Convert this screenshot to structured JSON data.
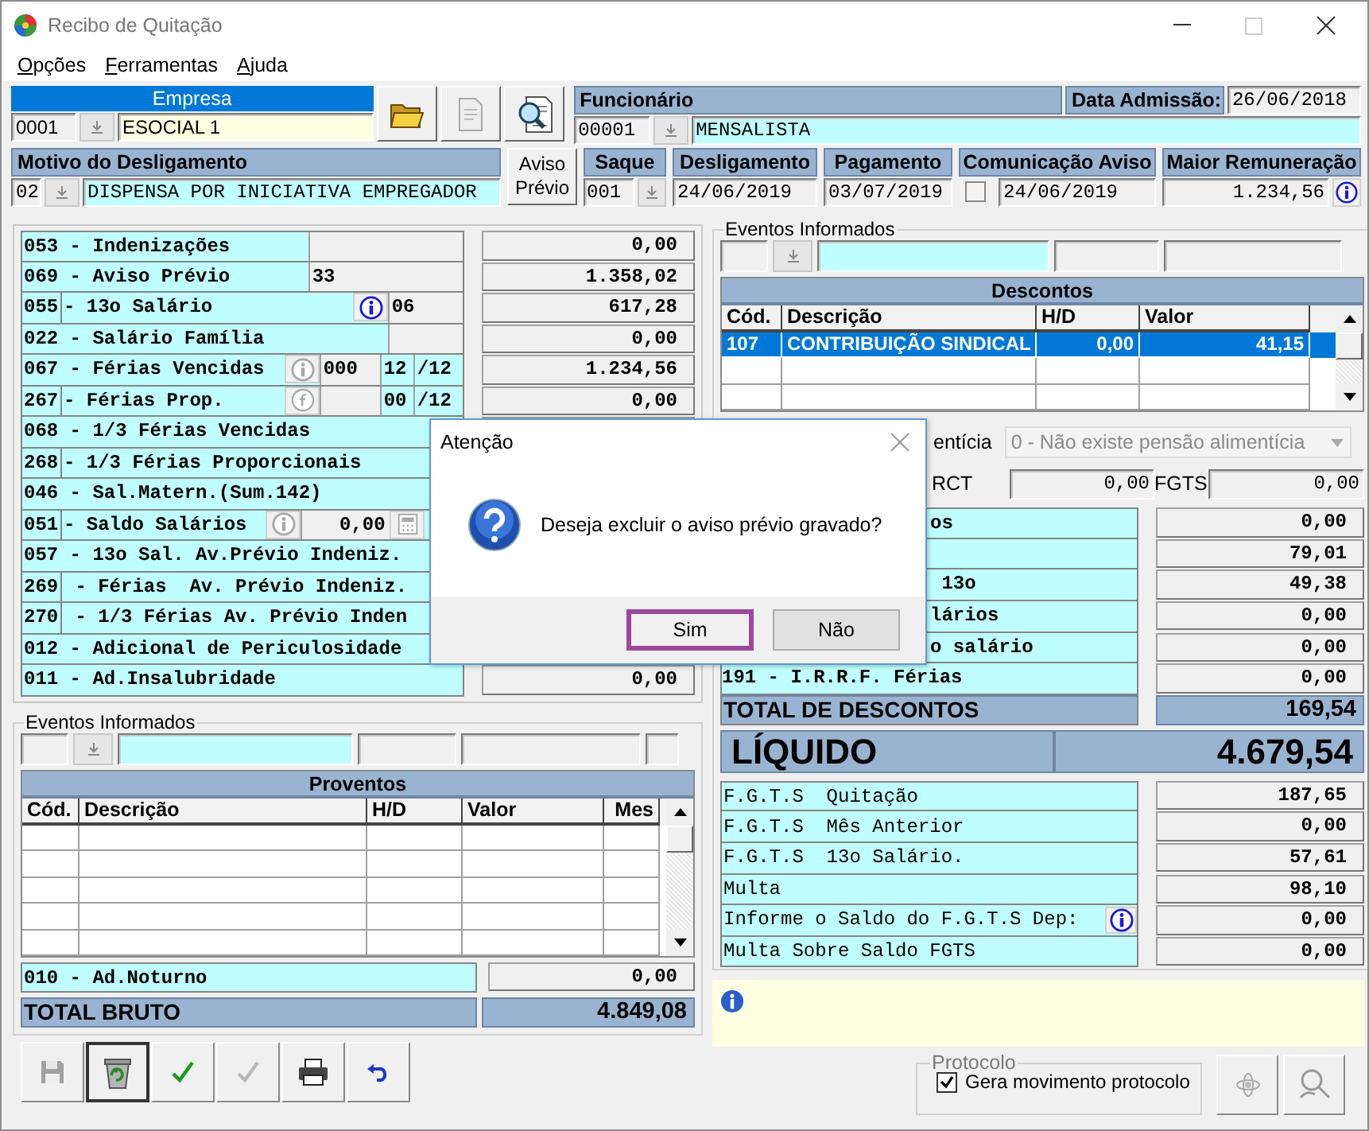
{
  "window": {
    "title": "Recibo de Quitação"
  },
  "menu": [
    {
      "label": "Opções"
    },
    {
      "label": "Ferramentas"
    },
    {
      "label": "Ajuda"
    }
  ],
  "empresa": {
    "header": "Empresa",
    "code": "0001",
    "name": "ESOCIAL 1"
  },
  "funcionario": {
    "header": "Funcionário",
    "admission_label": "Data Admissão:",
    "admission_date": "26/06/2018",
    "code": "00001",
    "name": "MENSALISTA"
  },
  "motivo": {
    "header": "Motivo do Desligamento",
    "code": "02",
    "text": "DISPENSA POR INICIATIVA EMPREGADOR"
  },
  "aviso_button": {
    "label": "Aviso Prévio"
  },
  "saque": {
    "header": "Saque",
    "code": "001"
  },
  "dates": [
    {
      "header": "Desligamento",
      "value": "24/06/2019"
    },
    {
      "header": "Pagamento",
      "value": "03/07/2019"
    }
  ],
  "comunicacao": {
    "header": "Comunicação Aviso",
    "checked": false,
    "value": "24/06/2019"
  },
  "maior_remuneracao": {
    "header": "Maior Remuneração",
    "value": "1.234,56"
  },
  "left_rows": [
    {
      "label": "053 - Indenizações",
      "extras": [
        {
          "kind": "extra-field"
        }
      ],
      "value": "0,00"
    },
    {
      "label": "069 - Aviso Prévio",
      "extras": [
        {
          "kind": "extra-field",
          "text": "33"
        }
      ],
      "value": "1.358,02"
    },
    {
      "code": "055",
      "label": "- 13o Salário",
      "extras": [
        {
          "kind": "info",
          "disabled": false
        },
        {
          "kind": "short-field",
          "text": "06"
        }
      ],
      "value": "617,28"
    },
    {
      "label": "022 - Salário Família",
      "extras": [
        {
          "kind": "short-field"
        }
      ],
      "value": "0,00"
    },
    {
      "label": "067 - Férias Vencidas",
      "extras": [
        {
          "kind": "info",
          "disabled": true
        },
        {
          "kind": "count-field",
          "text": "000"
        },
        {
          "kind": "month-field",
          "text": "12"
        },
        {
          "kind": "months-total",
          "text": "/12"
        }
      ],
      "value": "1.234,56"
    },
    {
      "code": "267",
      "label": "- Férias Prop.",
      "extras": [
        {
          "kind": "formula",
          "disabled": true
        },
        {
          "kind": "count-field"
        },
        {
          "kind": "month-field",
          "text": "00"
        },
        {
          "kind": "months-total",
          "text": "/12"
        }
      ],
      "value": "0,00"
    },
    {
      "label": "068 - 1/3 Férias Vencidas"
    },
    {
      "code": "268",
      "label": "- 1/3 Férias Proporcionais"
    },
    {
      "label": "046 - Sal.Matern.(Sum.142)"
    },
    {
      "code": "051",
      "label": "- Saldo Salários",
      "extras": [
        {
          "kind": "info",
          "disabled": true
        },
        {
          "kind": "amount-field",
          "text": "0,00"
        },
        {
          "kind": "calculator",
          "disabled": true
        }
      ]
    },
    {
      "label": "057 - 13o Sal. Av.Prévio Indeniz."
    },
    {
      "code": "269",
      "label": " - Férias  Av. Prévio Indeniz."
    },
    {
      "code": "270",
      "label": " - 1/3 Férias Av. Prévio Inden"
    },
    {
      "label": "012 - Adicional de Periculosidade"
    },
    {
      "label": "011 - Ad.Insalubridade",
      "value": "0,00"
    }
  ],
  "eventos_left": {
    "title": "Eventos Informados",
    "table_title": "Proventos",
    "columns": [
      "Cód.",
      "Descrição",
      "H/D",
      "Valor",
      "Mes"
    ]
  },
  "noturno": {
    "label": "010 - Ad.Noturno",
    "value": "0,00"
  },
  "total_bruto": {
    "label": "TOTAL BRUTO",
    "value": "4.849,08"
  },
  "toolbar": [
    {
      "kind": "save",
      "disabled": true,
      "focused": false
    },
    {
      "kind": "recycle",
      "disabled": false,
      "focused": true
    },
    {
      "kind": "confirm",
      "disabled": false,
      "focused": false
    },
    {
      "kind": "confirm",
      "disabled": true,
      "focused": false
    },
    {
      "kind": "print",
      "disabled": false,
      "focused": false
    },
    {
      "kind": "undo",
      "disabled": false,
      "focused": false
    }
  ],
  "eventos_right": {
    "title": "Eventos Informados",
    "table_title": "Descontos",
    "columns": [
      "Cód.",
      "Descrição",
      "H/D",
      "Valor"
    ],
    "rows": [
      {
        "cells": [
          "107",
          "CONTRIBUIÇÃO SINDICAL",
          "0,00",
          "41,15"
        ],
        "selected": true
      }
    ]
  },
  "pensao": {
    "label": "entícia",
    "value": "0 - Não existe pensão alimentícia",
    "disabled": true
  },
  "rct": {
    "label": "RCT",
    "value": "0,00"
  },
  "fgts": {
    "label": "FGTS",
    "value": "0,00"
  },
  "descontos_rows": [
    {
      "kind": "cut",
      "label": "os",
      "value": "0,00"
    },
    {
      "kind": "cut",
      "value": "79,01"
    },
    {
      "kind": "cut",
      "label": " 13o",
      "value": "49,38"
    },
    {
      "kind": "cut",
      "label": "lários",
      "value": "0,00"
    },
    {
      "kind": "cut",
      "label": "o salário",
      "value": "0,00"
    },
    {
      "kind": "full",
      "label": "191 - I.R.R.F. Férias",
      "value": "0,00"
    }
  ],
  "total_descontos": {
    "label": "TOTAL DE DESCONTOS",
    "value": "169,54"
  },
  "liquido": {
    "label": "LÍQUIDO",
    "value": "4.679,54"
  },
  "fgts_rows": [
    {
      "label": "F.G.T.S  Quitação",
      "info": false,
      "value": "187,65"
    },
    {
      "label": "F.G.T.S  Mês Anterior",
      "info": false,
      "value": "0,00"
    },
    {
      "label": "F.G.T.S  13o Salário.",
      "info": false,
      "value": "57,61"
    },
    {
      "label": "Multa",
      "info": false,
      "value": "98,10"
    },
    {
      "label": "Informe o Saldo do F.G.T.S Dep:",
      "info": true,
      "value": "0,00"
    },
    {
      "label": "Multa Sobre Saldo FGTS",
      "info": false,
      "value": "0,00"
    }
  ],
  "protocolo": {
    "title": "Protocolo",
    "checkbox": {
      "label": "Gera movimento protocolo",
      "checked": true
    }
  },
  "dialog": {
    "title": "Atenção",
    "message": "Deseja excluir o aviso prévio gravado?",
    "buttons": [
      {
        "label": "Sim",
        "selected": true
      },
      {
        "label": "Não",
        "selected": false
      }
    ]
  }
}
